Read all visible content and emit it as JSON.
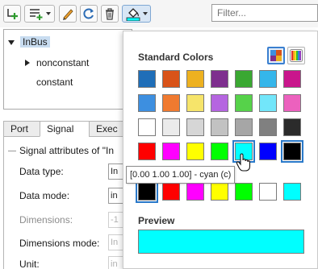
{
  "toolbar": {
    "filter_placeholder": "Filter..."
  },
  "tree": {
    "items": [
      {
        "label": "InBus",
        "expanded": true,
        "selected": true
      },
      {
        "label": "nonconstant",
        "expanded": false
      },
      {
        "label": "constant"
      }
    ]
  },
  "tabs": [
    {
      "label": "Port"
    },
    {
      "label": "Signal",
      "active": true
    },
    {
      "label": "Exec"
    }
  ],
  "panel": {
    "section_title": "Signal attributes of \"In",
    "fields": [
      {
        "label": "Data type:",
        "value": "In",
        "disabled": false
      },
      {
        "label": "Data mode:",
        "value": "in",
        "disabled": false
      },
      {
        "label": "Dimensions:",
        "value": "-1",
        "disabled": true
      },
      {
        "label": "Dimensions mode:",
        "value": "In",
        "disabled": true
      },
      {
        "label": "Unit:",
        "value": "in",
        "disabled": true
      }
    ]
  },
  "color_popup": {
    "title": "Standard Colors",
    "standard_colors": [
      [
        "#1f6eb8",
        "#d95319",
        "#edb120",
        "#7e2f8e",
        "#3aa832",
        "#35b6ea",
        "#c9168c"
      ],
      [
        "#3d8fe0",
        "#f07a30",
        "#f6e46a",
        "#b565e0",
        "#56d24a",
        "#72e6fa",
        "#ec61be"
      ],
      [
        "#ffffff",
        "#ebebeb",
        "#d6d6d6",
        "#c2c2c2",
        "#a6a6a6",
        "#808080",
        "#2b2b2b"
      ],
      [
        "#ff0000",
        "#ff00ff",
        "#ffff00",
        "#00ff00",
        "#00ffff",
        "#0000ff",
        "#000000"
      ]
    ],
    "hovered_color": "#00ffff",
    "selected_color": "#000000",
    "tooltip": "[0.00 1.00 1.00] - cyan (c)",
    "recent_colors": [
      "#000000",
      "#ff0000",
      "#ff00ff",
      "#ffff00",
      "#00ff00",
      "#ffffff",
      "#00ffff"
    ],
    "preview_label": "Preview",
    "preview_color": "#00ffff",
    "accent": "#2a79c9"
  }
}
